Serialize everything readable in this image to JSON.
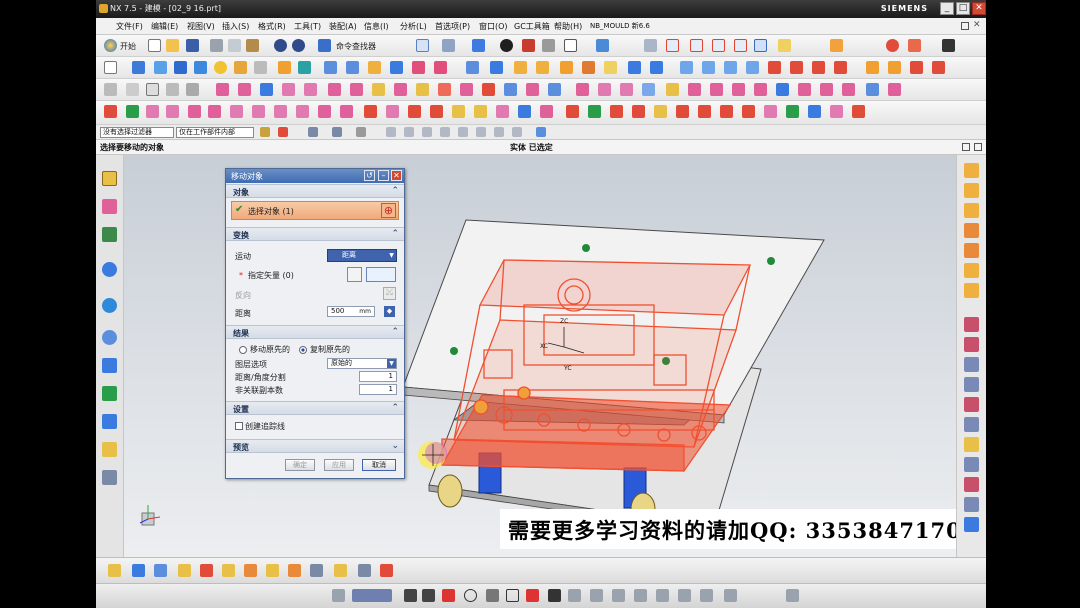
{
  "window": {
    "title": "NX 7.5 - 建模 - [02_9 16.prt]",
    "brand": "SIEMENS",
    "controls": [
      "_",
      "□",
      "✕"
    ]
  },
  "menubar": {
    "items": [
      "文件(F)",
      "编辑(E)",
      "视图(V)",
      "插入(S)",
      "格式(R)",
      "工具(T)",
      "装配(A)",
      "信息(I)",
      "分析(L)",
      "首选项(P)",
      "窗口(O)",
      "GC工具箱",
      "帮助(H)",
      "NB_MOULD 新6.6"
    ]
  },
  "toolbar": {
    "start_label": "开始",
    "command_finder_label": "命令查找器"
  },
  "selection_bar": {
    "filter_value": "没有选择过滤器",
    "scope_value": "仅在工作部件内部"
  },
  "cue_line": {
    "prompt": "选择要移动的对象",
    "status": "实体 已选定"
  },
  "dialog": {
    "title": "移动对象",
    "object_group": "对象",
    "select_object_label": "选择对象 (1)",
    "transform_group": "变换",
    "motion_label": "运动",
    "motion_value": "距离",
    "specify_vector_label": "指定矢量 (0)",
    "reverse_label": "反向",
    "distance_label": "距离",
    "distance_value": "500",
    "distance_unit": "mm",
    "result_group": "结果",
    "move_original_label": "移动原先的",
    "copy_original_label": "复制原先的",
    "layer_option_label": "图层选项",
    "layer_option_value": "原始的",
    "distance_divisions_label": "距离/角度分割",
    "distance_divisions_value": "1",
    "non_assoc_copies_label": "非关联副本数",
    "non_assoc_copies_value": "1",
    "settings_group": "设置",
    "create_trace_label": "创建追踪线",
    "preview_group": "预览",
    "ok_button": "确定",
    "apply_button": "应用",
    "cancel_button": "取消"
  },
  "viewport": {
    "axis_labels": [
      "XC",
      "YC",
      "ZC"
    ],
    "banner_text": "需要更多学习资料的请加QQ: 3353847170"
  },
  "colors": {
    "title_bar": "#2a2a2a",
    "dialog_title": "#3e6cb3",
    "selected_object": "#f05030",
    "plate": "#e8e8e8",
    "springs": "#2a5ad8",
    "bottom_bar_accent": "#6e7fb0"
  }
}
